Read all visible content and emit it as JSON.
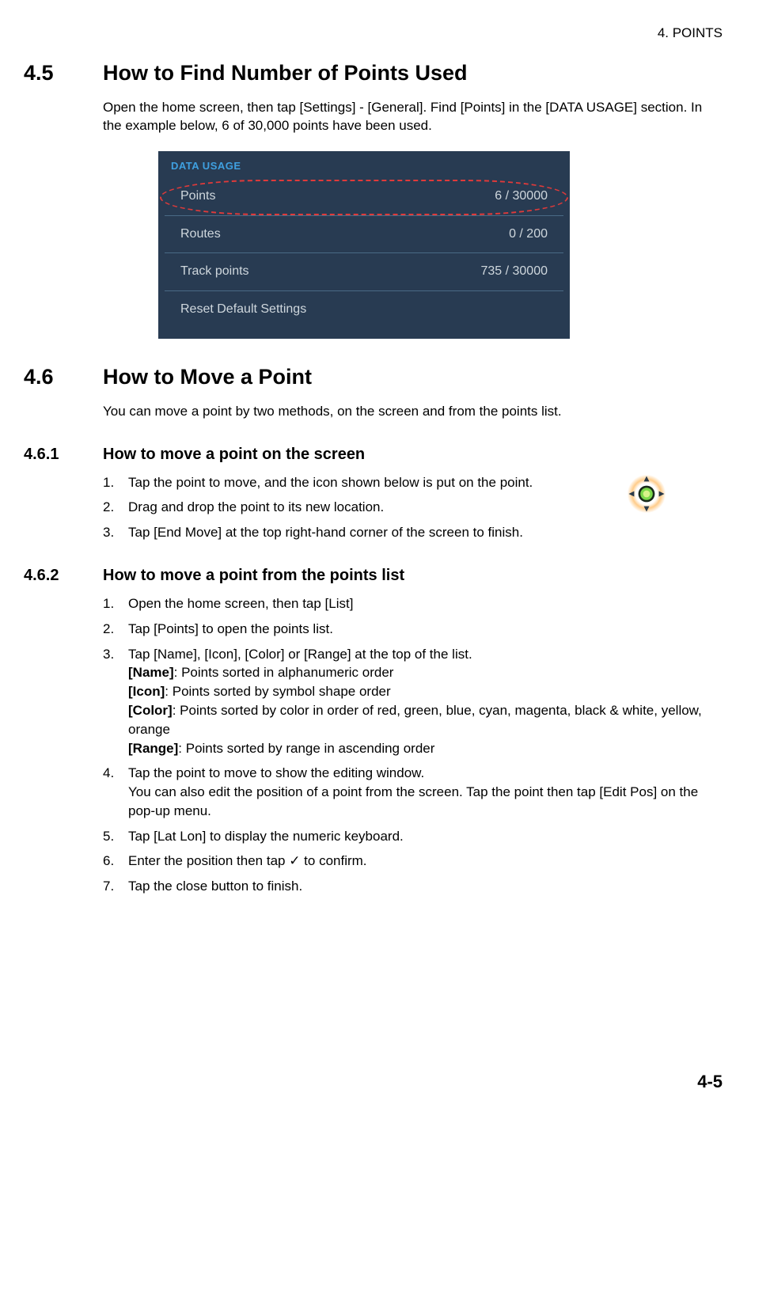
{
  "header": {
    "chapter": "4.  POINTS"
  },
  "s45": {
    "num": "4.5",
    "title": "How to Find Number of Points Used",
    "body": "Open the home screen, then tap [Settings] - [General]. Find [Points] in the [DATA USAGE] section. In the example below, 6 of 30,000 points have been used."
  },
  "panel": {
    "title": "DATA USAGE",
    "rows": {
      "points": {
        "label": "Points",
        "value": "6 / 30000"
      },
      "routes": {
        "label": "Routes",
        "value": "0 / 200"
      },
      "trackpoints": {
        "label": "Track points",
        "value": "735 / 30000"
      },
      "reset": {
        "label": "Reset Default Settings"
      }
    }
  },
  "s46": {
    "num": "4.6",
    "title": "How to Move a Point",
    "body": "You can move a point by two methods, on the screen and from the points list."
  },
  "s461": {
    "num": "4.6.1",
    "title": "How to move a point on the screen",
    "steps": [
      "Tap the point to move, and the icon shown below is put on the point.",
      "Drag and drop the point to its new location.",
      "Tap [End Move] at the top right-hand corner of the screen to finish."
    ]
  },
  "s462": {
    "num": "4.6.2",
    "title": "How to move a point from the points list",
    "steps": {
      "s1": "Open the home screen, then tap [List]",
      "s2": "Tap [Points] to open the points list.",
      "s3_intro": "Tap [Name], [Icon], [Color] or [Range] at the top of the list.",
      "s3_name_label": "[Name]",
      "s3_name": ": Points sorted in alphanumeric order",
      "s3_icon_label": "[Icon]",
      "s3_icon": ": Points sorted by symbol shape order",
      "s3_color_label": "[Color]",
      "s3_color": ": Points sorted by color in order of red, green, blue, cyan, magenta, black & white, yellow, orange",
      "s3_range_label": "[Range]",
      "s3_range": ": Points sorted by range in ascending order",
      "s4_a": "Tap the point to move to show the editing window.",
      "s4_b": "You can also edit the position of a point from the screen. Tap the point then tap [Edit Pos] on the pop-up menu.",
      "s5": "Tap [Lat Lon] to display the numeric keyboard.",
      "s6": "Enter the position then tap ✓ to confirm.",
      "s7": "Tap the close button to finish."
    }
  },
  "footer": {
    "page": "4-5"
  }
}
